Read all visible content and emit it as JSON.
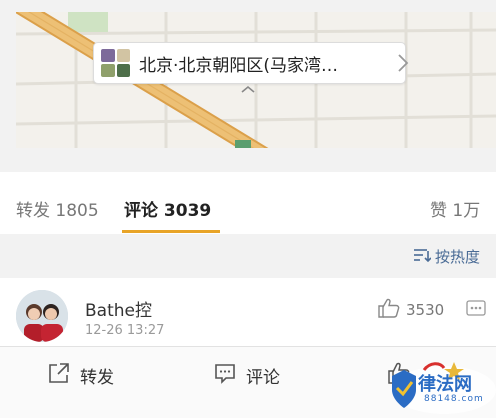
{
  "location": {
    "text": "北京·北京朝阳区(马家湾…",
    "chevron_icon": "chevron-right-icon"
  },
  "tabs": [
    {
      "label": "转发 1805"
    },
    {
      "label": "评论 3039"
    },
    {
      "label": "赞 1万"
    }
  ],
  "sort": {
    "label": "按热度",
    "icon": "sort-icon"
  },
  "comment": {
    "username": "Bathe控",
    "time": "12-26 13:27",
    "like_count": "3530"
  },
  "bottom_bar": {
    "repost_label": "转发",
    "comment_label": "评论"
  },
  "watermark": {
    "title": "律法网",
    "subtitle": "88148.com"
  },
  "colors": {
    "accent": "#e8a427",
    "link": "#4b6c96",
    "map_road": "#e1a84b"
  }
}
